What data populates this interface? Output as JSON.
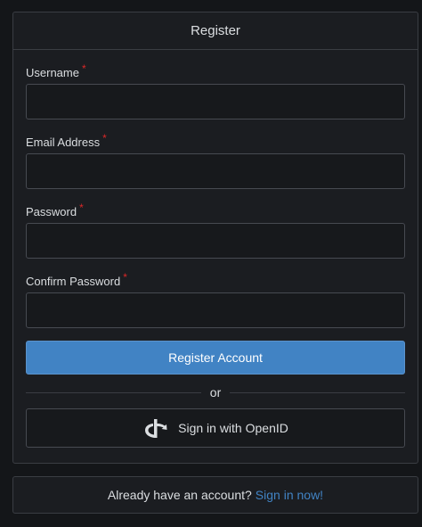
{
  "register": {
    "title": "Register",
    "fields": [
      {
        "label": "Username",
        "required": "*",
        "value": ""
      },
      {
        "label": "Email Address",
        "required": "*",
        "value": ""
      },
      {
        "label": "Password",
        "required": "*",
        "value": ""
      },
      {
        "label": "Confirm Password",
        "required": "*",
        "value": ""
      }
    ],
    "submit_label": "Register Account",
    "divider_text": "or",
    "openid_label": "Sign in with OpenID"
  },
  "signin": {
    "prompt": "Already have an account?",
    "link_label": "Sign in now!"
  },
  "colors": {
    "accent": "#4183c4",
    "required": "#db2828",
    "background": "#141619",
    "card": "#1b1d21"
  }
}
